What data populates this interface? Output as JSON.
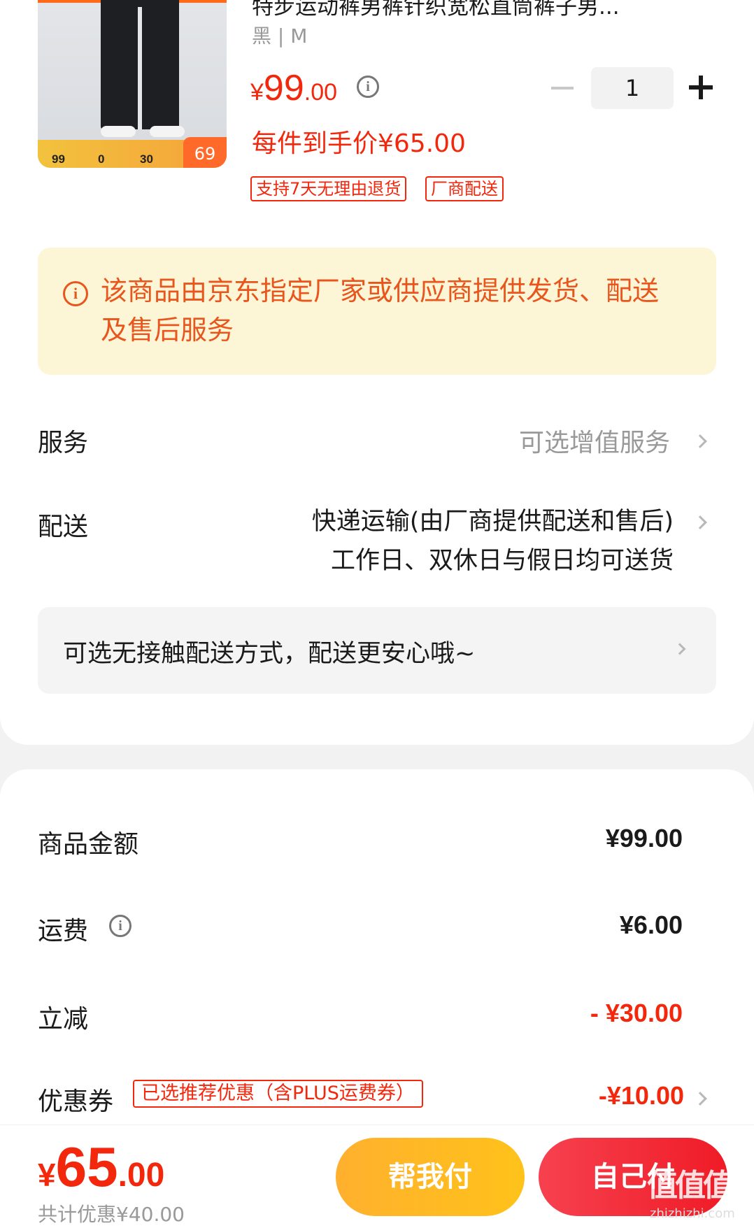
{
  "product": {
    "title": "特步运动裤男裤针织宽松直筒裤子男...",
    "spec": "黑 | M",
    "price_currency": "¥",
    "price_int": "99",
    "price_dec": ".00",
    "unit_price": "每件到手价¥65.00",
    "quantity": "1",
    "tags": [
      "支持7天无理由退货",
      "厂商配送"
    ],
    "image": {
      "nums": [
        "99",
        "0",
        "30"
      ],
      "badge": "69"
    }
  },
  "notice": {
    "text": "该商品由京东指定厂家或供应商提供发货、配送及售后服务"
  },
  "service": {
    "label": "服务",
    "value": "可选增值服务"
  },
  "delivery": {
    "label": "配送",
    "line1": "快递运输(由厂商提供配送和售后)",
    "line2": "工作日、双休日与假日均可送货"
  },
  "contactless": {
    "text": "可选无接触配送方式，配送更安心哦~"
  },
  "summary": {
    "goods_label": "商品金额",
    "goods_value": "¥99.00",
    "shipping_label": "运费",
    "shipping_value": "¥6.00",
    "discount_label": "立减",
    "discount_value": "- ¥30.00",
    "coupon_label": "优惠券",
    "coupon_tag": "已选推荐优惠（含PLUS运费券）",
    "coupon_value": "-¥10.00"
  },
  "bottom": {
    "total_currency": "¥",
    "total_int": "65",
    "total_dec": ".00",
    "total_save": "共计优惠¥40.00",
    "help_pay": "帮我付",
    "self_pay": "自己付",
    "watermark": "值值值",
    "watermark_url": "zhizhizhi.com"
  },
  "colors": {
    "accent_red": "#f2270c",
    "notice_bg": "#fdf6d6",
    "notice_text": "#e8561e",
    "help_btn": "#ffb02e",
    "self_btn": "#ef1b26"
  }
}
